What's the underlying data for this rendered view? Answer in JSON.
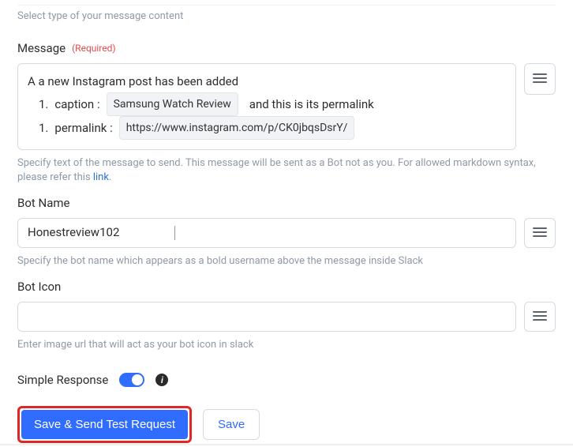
{
  "top_helper": "Select type of your message content",
  "message": {
    "label": "Message",
    "required_tag": "(Required)",
    "intro": "A a new Instagram post has been added",
    "items": [
      {
        "num": "1.",
        "key": "caption :",
        "value": "Samsung Watch Review",
        "after": "and this is its permalink"
      },
      {
        "num": "1.",
        "key": "permalink :",
        "value": "https://www.instagram.com/p/CK0jbqsDsrY/",
        "after": ""
      }
    ],
    "helper_pre": "Specify text of the message to send. This message will be sent as a Bot not as you. For allowed markdown syntax, please refer this ",
    "helper_link": "link",
    "helper_post": "."
  },
  "botname": {
    "label": "Bot Name",
    "value": "Honestreview102",
    "helper": "Specify the bot name which appears as a bold username above the message inside Slack"
  },
  "boticon": {
    "label": "Bot Icon",
    "value": "",
    "helper": "Enter image url that will act as your bot icon in slack"
  },
  "simple_response": {
    "label": "Simple Response",
    "on": true
  },
  "buttons": {
    "primary": "Save & Send Test Request",
    "secondary": "Save"
  },
  "icons": {
    "menu": "menu-icon",
    "info": "i"
  }
}
